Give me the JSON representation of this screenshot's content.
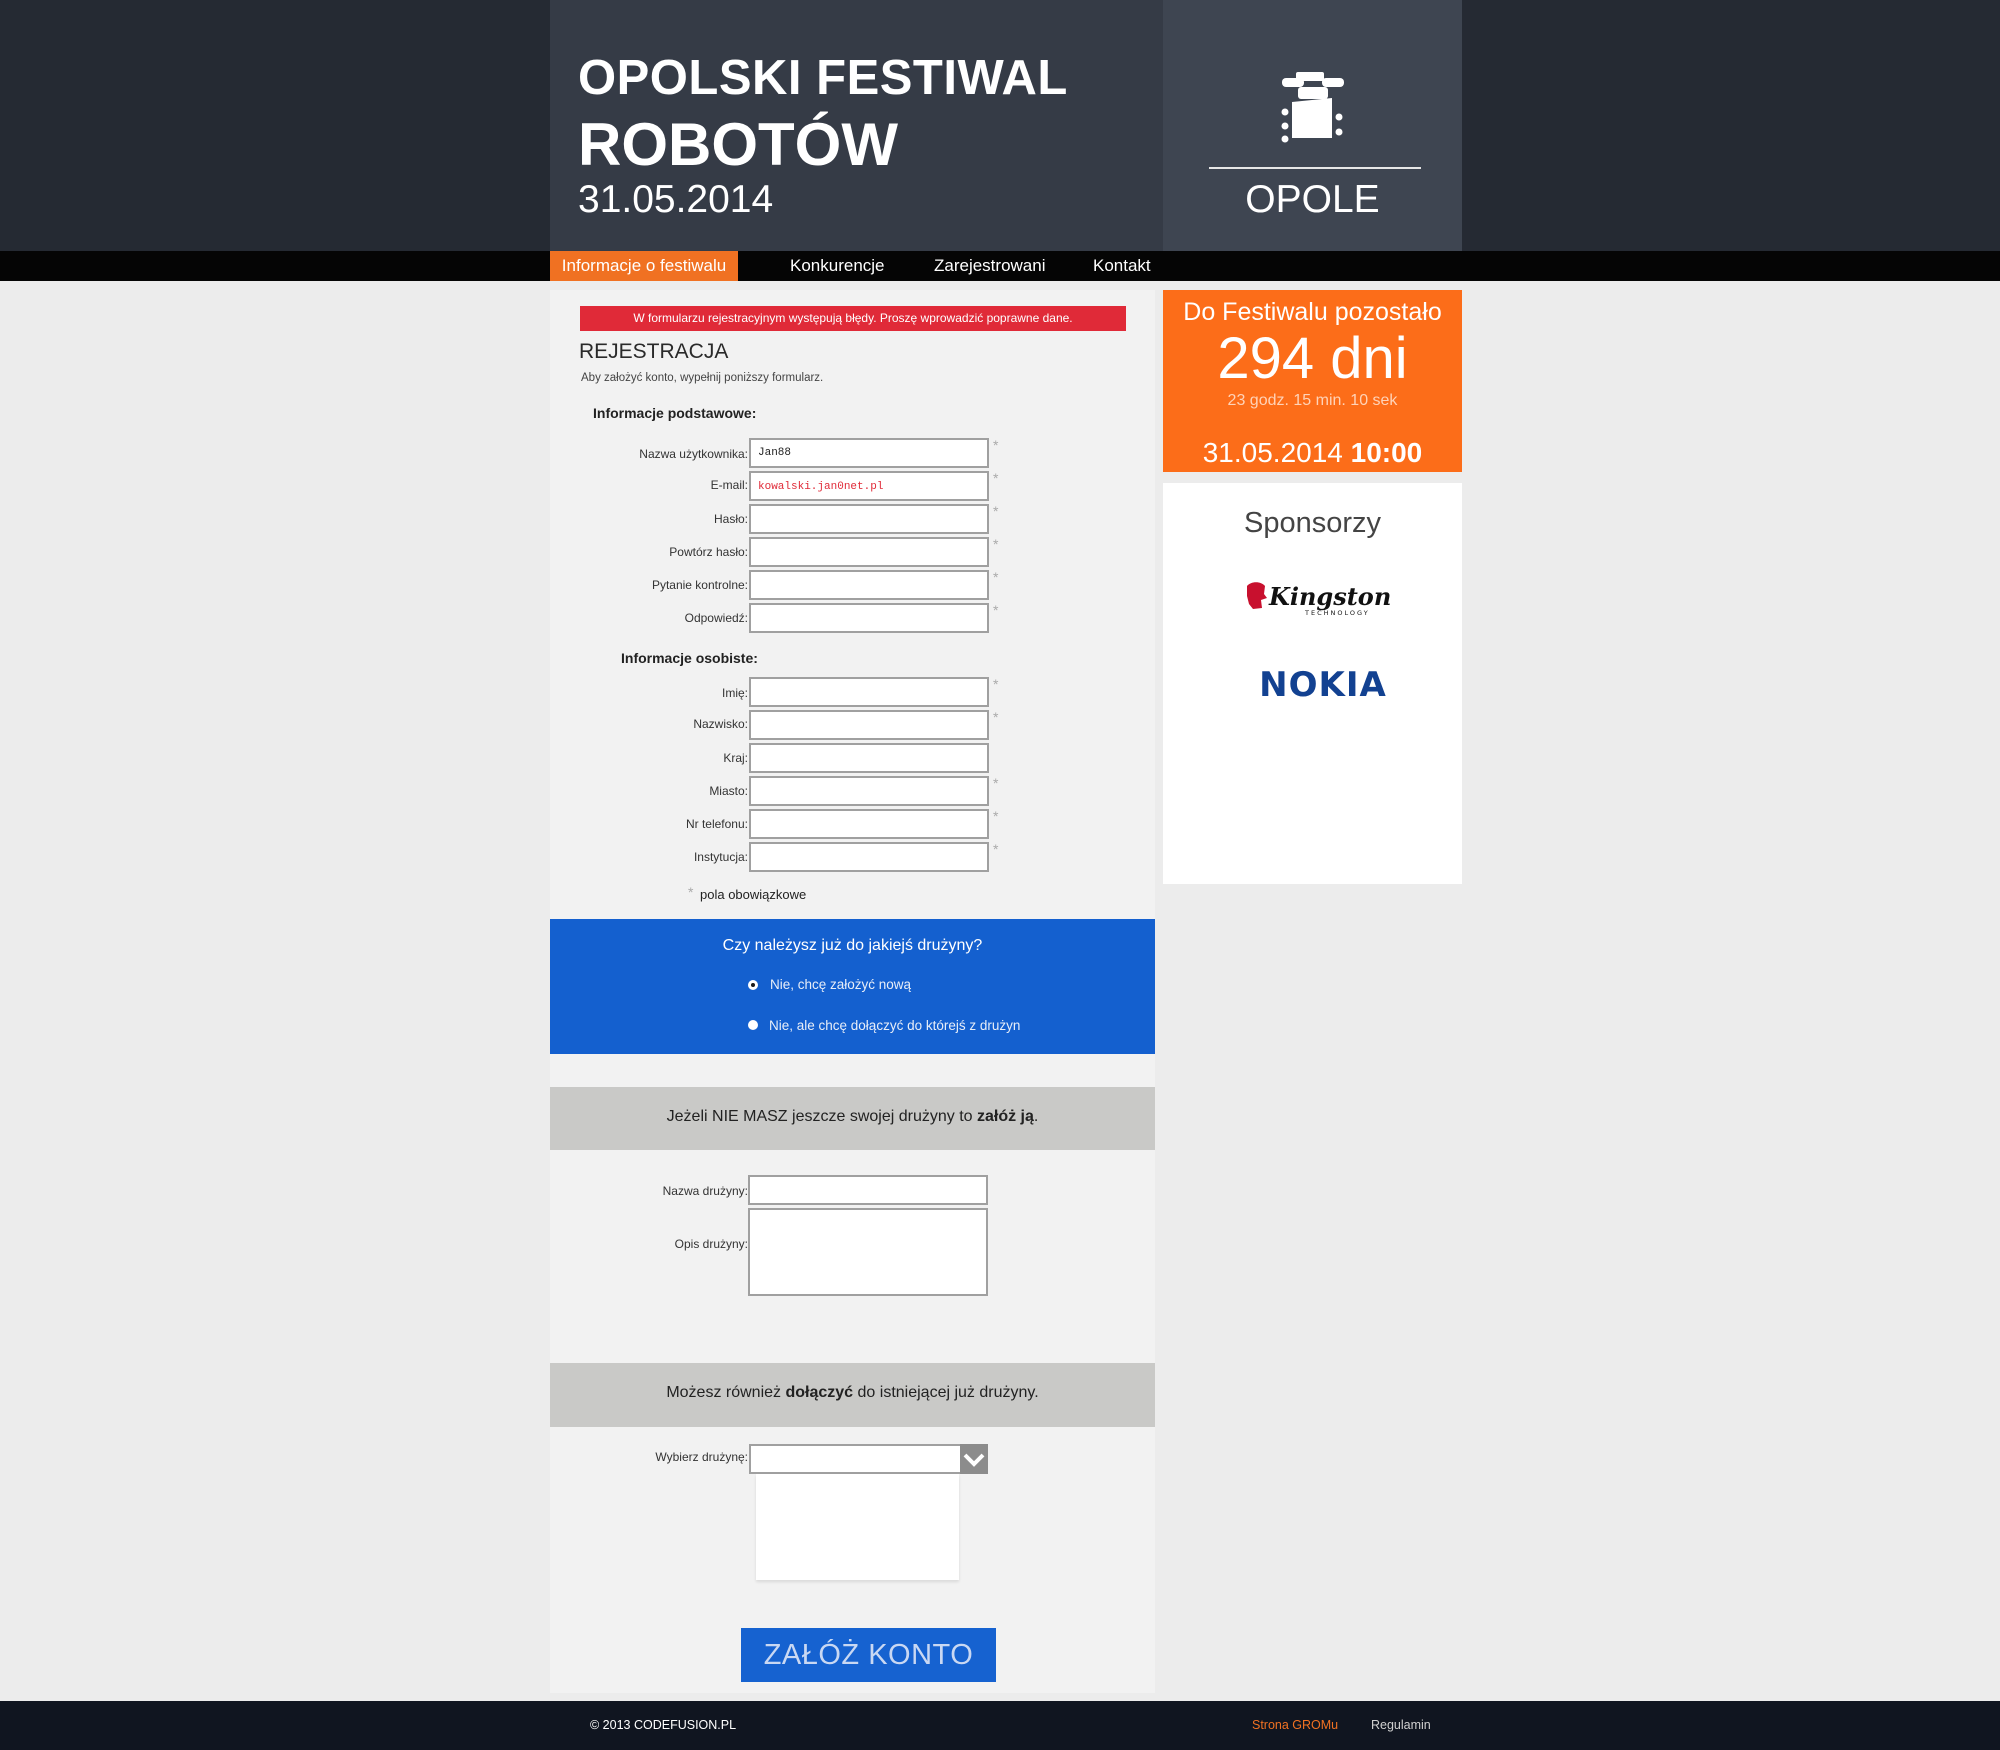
{
  "header": {
    "title_line1": "OPOLSKI FESTIWAL",
    "title_line2": "ROBOTÓW",
    "date": "31.05.2014",
    "city": "OPOLE"
  },
  "nav": {
    "items": [
      "Informacje o festiwalu",
      "Konkurencje",
      "Zarejestrowani",
      "Kontakt"
    ],
    "active_index": 0
  },
  "form": {
    "error_message": "W formularzu rejestracyjnym występują błędy. Proszę wprowadzić poprawne dane.",
    "title": "REJESTRACJA",
    "subtitle": "Aby założyć konto, wypełnij poniższy formularz.",
    "basic_section": "Informacje podstawowe:",
    "personal_section": "Informacje osobiste:",
    "basic_fields": [
      {
        "label": "Nazwa użytkownika:",
        "value": "Jan88",
        "required": true
      },
      {
        "label": "E-mail:",
        "value": "kowalski.jan0net.pl",
        "required": true
      },
      {
        "label": "Hasło:",
        "value": "",
        "required": true
      },
      {
        "label": "Powtórz hasło:",
        "value": "",
        "required": true
      },
      {
        "label": "Pytanie kontrolne:",
        "value": "",
        "required": true
      },
      {
        "label": "Odpowiedź:",
        "value": "",
        "required": true
      }
    ],
    "personal_fields": [
      {
        "label": "Imię:",
        "value": "",
        "required": true
      },
      {
        "label": "Nazwisko:",
        "value": "",
        "required": true
      },
      {
        "label": "Kraj:",
        "value": "",
        "required": false
      },
      {
        "label": "Miasto:",
        "value": "",
        "required": true
      },
      {
        "label": "Nr telefonu:",
        "value": "",
        "required": true
      },
      {
        "label": "Instytucja:",
        "value": "",
        "required": true
      }
    ],
    "required_star": "*",
    "required_note": "pola obowiązkowe"
  },
  "team": {
    "question": "Czy należysz już do jakiejś drużyny?",
    "option_new": "Nie, chcę założyć nową",
    "option_join": "Nie, ale chcę dołączyć do którejś z drużyn",
    "selected_option": "new",
    "create_text_before": "Jeżeli NIE MASZ jeszcze swojej drużyny to ",
    "create_text_bold": "załóż ją",
    "create_text_after": ".",
    "team_name_label": "Nazwa drużyny:",
    "team_desc_label": "Opis drużyny:",
    "join_text_before": "Możesz również ",
    "join_text_bold": "dołączyć",
    "join_text_after": " do istniejącej już drużyny.",
    "select_label": "Wybierz drużynę:",
    "select_value": ""
  },
  "submit_label": "ZAŁÓŻ KONTO",
  "countdown": {
    "title": "Do Festiwalu pozostało",
    "days": "294 dni",
    "time": "23 godz. 15 min. 10 sek",
    "date": "31.05.2014",
    "hour": "10:00"
  },
  "sponsors": {
    "title": "Sponsorzy",
    "logos": [
      "Kingston Technology",
      "NOKIA"
    ]
  },
  "footer": {
    "copyright": "© 2013 CODEFUSION.PL",
    "link1": "Strona GROMu",
    "link2": "Regulamin"
  },
  "colors": {
    "accent_orange": "#f07122",
    "countdown_orange": "#fc6d19",
    "blue": "#1460cf",
    "error_red": "#e02a38",
    "header_dark": "#252a33"
  }
}
